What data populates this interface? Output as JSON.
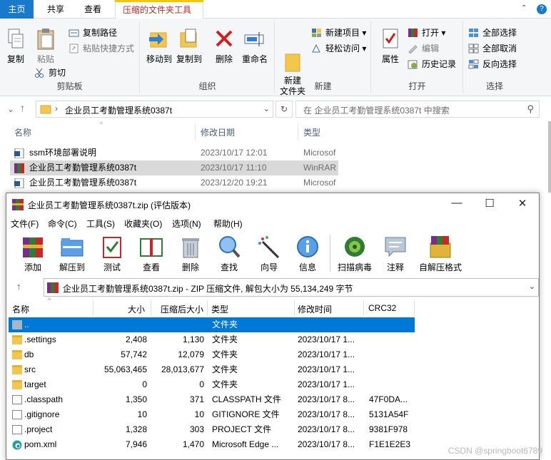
{
  "explorer": {
    "tabs": [
      "主页",
      "共享",
      "查看",
      "压缩的文件夹工具"
    ],
    "ribbon": {
      "clipboard": {
        "label": "剪贴板",
        "copy": "复制",
        "paste": "粘贴",
        "copy_path": "复制路径",
        "paste_shortcut": "粘贴快捷方式",
        "cut": "剪切"
      },
      "organize": {
        "label": "组织",
        "move_to": "移动到",
        "copy_to": "复制到",
        "delete": "删除",
        "rename": "重命名"
      },
      "new": {
        "label": "新建",
        "new_folder": "新建\n文件夹",
        "new_item": "新建项目",
        "easy_access": "轻松访问"
      },
      "open": {
        "label": "打开",
        "properties": "属性",
        "open": "打开",
        "edit": "编辑",
        "history": "历史记录"
      },
      "select": {
        "label": "选择",
        "select_all": "全部选择",
        "select_none": "全部取消",
        "invert": "反向选择"
      }
    },
    "address": "企业员工考勤管理系统0387t",
    "search_placeholder": "在 企业员工考勤管理系统0387t 中搜索",
    "columns": [
      "名称",
      "修改日期",
      "类型"
    ],
    "files": [
      {
        "name": "ssm环境部署说明",
        "date": "2023/10/17 12:01",
        "type": "Microsof"
      },
      {
        "name": "企业员工考勤管理系统0387t",
        "date": "2023/10/17 11:10",
        "type": "WinRAR"
      },
      {
        "name": "企业员工考勤管理系统0387t",
        "date": "2023/12/20 19:21",
        "type": "Microsof"
      }
    ]
  },
  "winrar": {
    "title": "企业员工考勤管理系统0387t.zip (评估版本)",
    "menu": [
      "文件(F)",
      "命令(C)",
      "工具(S)",
      "收藏夹(O)",
      "选项(N)",
      "帮助(H)"
    ],
    "toolbar": [
      "添加",
      "解压到",
      "测试",
      "查看",
      "删除",
      "查找",
      "向导",
      "信息",
      "扫描病毒",
      "注释",
      "自解压格式"
    ],
    "path": "企业员工考勤管理系统0387t.zip - ZIP 压缩文件, 解包大小为 55,134,249 字节",
    "columns": [
      "名称",
      "大小",
      "压缩后大小",
      "类型",
      "修改时间",
      "CRC32"
    ],
    "rows": [
      {
        "name": "..",
        "size": "",
        "packed": "",
        "type": "文件夹",
        "modified": "",
        "crc": ""
      },
      {
        "name": ".settings",
        "size": "2,408",
        "packed": "1,130",
        "type": "文件夹",
        "modified": "2023/10/17 1...",
        "crc": ""
      },
      {
        "name": "db",
        "size": "57,742",
        "packed": "12,079",
        "type": "文件夹",
        "modified": "2023/10/17 1...",
        "crc": ""
      },
      {
        "name": "src",
        "size": "55,063,465",
        "packed": "28,013,677",
        "type": "文件夹",
        "modified": "2023/10/17 1...",
        "crc": ""
      },
      {
        "name": "target",
        "size": "0",
        "packed": "0",
        "type": "文件夹",
        "modified": "2023/10/17 1...",
        "crc": ""
      },
      {
        "name": ".classpath",
        "size": "1,350",
        "packed": "371",
        "type": "CLASSPATH 文件",
        "modified": "2023/10/17 8...",
        "crc": "47F0DA..."
      },
      {
        "name": ".gitignore",
        "size": "10",
        "packed": "10",
        "type": "GITIGNORE 文件",
        "modified": "2023/10/17 8...",
        "crc": "5131A54F"
      },
      {
        "name": ".project",
        "size": "1,328",
        "packed": "303",
        "type": "PROJECT 文件",
        "modified": "2023/10/17 8...",
        "crc": "9381F978"
      },
      {
        "name": "pom.xml",
        "size": "7,946",
        "packed": "1,470",
        "type": "Microsoft Edge ...",
        "modified": "2023/10/17 8...",
        "crc": "F1E1E2E3"
      }
    ]
  },
  "watermark": "CSDN @springboot6789"
}
